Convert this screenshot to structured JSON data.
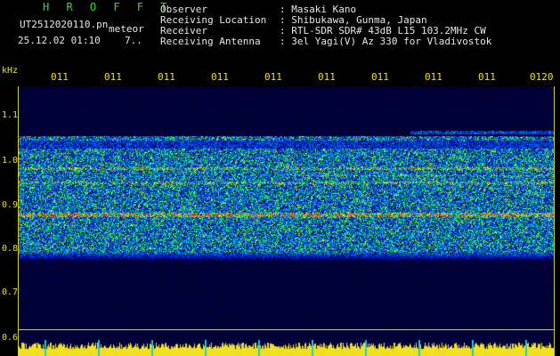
{
  "header": {
    "mode": "H R O F F T",
    "filename": "UT2512020110.pn",
    "kind": "meteor",
    "datetime": "25.12.02 01:10",
    "count": "7..",
    "fields": [
      {
        "label": "Observer",
        "value": ": Masaki Kano"
      },
      {
        "label": "Receiving Location",
        "value": ": Shibukawa, Gunma, Japan"
      },
      {
        "label": "Receiver",
        "value": ": RTL-SDR SDR# 43dB L15 103.2MHz CW"
      },
      {
        "label": "Receiving Antenna",
        "value": ": 3el Yagi(V) Az 330 for Vladivostok"
      }
    ]
  },
  "axis": {
    "unit": "kHz",
    "y_ticks": [
      "1.1",
      "1.0",
      "0.9",
      "0.8",
      "0.7",
      "0.6"
    ],
    "x_ticks": [
      "011",
      "011",
      "011",
      "011",
      "011",
      "011",
      "011",
      "011",
      "011",
      "0120"
    ]
  },
  "colors": {
    "background": "#000000",
    "label": "#f0e020",
    "title": "#33dd33",
    "text": "#e8e8e8",
    "marker": "#22cccc"
  }
}
